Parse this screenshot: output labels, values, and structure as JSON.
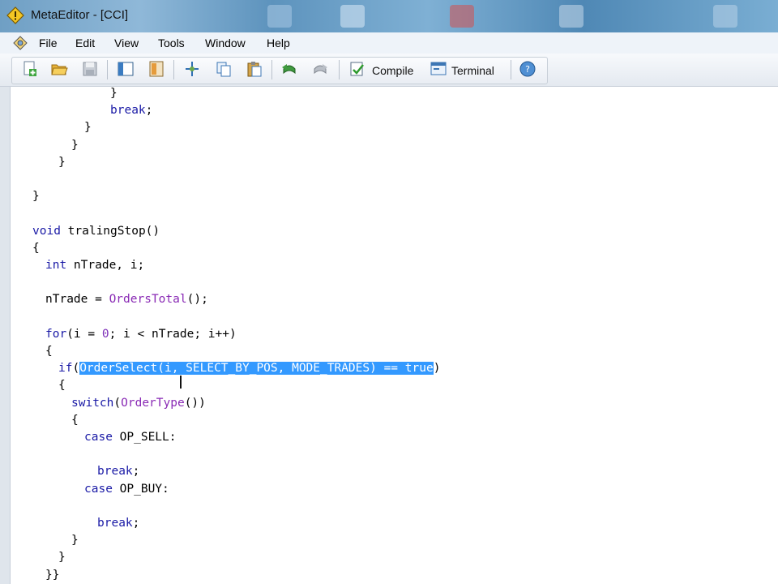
{
  "window": {
    "title": "MetaEditor - [CCI]"
  },
  "menu": {
    "items": [
      "File",
      "Edit",
      "View",
      "Tools",
      "Window",
      "Help"
    ]
  },
  "toolbar": {
    "compile_label": "Compile",
    "terminal_label": "Terminal"
  },
  "code": {
    "lines": [
      {
        "indent": "            ",
        "text": "}"
      },
      {
        "indent": "            ",
        "text": "break;"
      },
      {
        "indent": "        ",
        "text": "}"
      },
      {
        "indent": "      ",
        "text": "}"
      },
      {
        "indent": "    ",
        "text": "}"
      },
      {
        "indent": "",
        "text": ""
      },
      {
        "indent": "",
        "text": "}"
      },
      {
        "indent": "",
        "text": ""
      },
      {
        "indent": "",
        "text": "void tralingStop()"
      },
      {
        "indent": "",
        "text": "{"
      },
      {
        "indent": "  ",
        "text": "int nTrade, i;"
      },
      {
        "indent": "",
        "text": ""
      },
      {
        "indent": "  ",
        "text": "nTrade = OrdersTotal();"
      },
      {
        "indent": "",
        "text": ""
      },
      {
        "indent": "  ",
        "text": "for(i = 0; i < nTrade; i++)"
      },
      {
        "indent": "  ",
        "text": "{"
      },
      {
        "indent": "    ",
        "text": "if(OrderSelect(i, SELECT_BY_POS, MODE_TRADES) == true)"
      },
      {
        "indent": "    ",
        "text": "{"
      },
      {
        "indent": "      ",
        "text": "switch(OrderType())"
      },
      {
        "indent": "      ",
        "text": "{"
      },
      {
        "indent": "        ",
        "text": "case OP_SELL:"
      },
      {
        "indent": "",
        "text": ""
      },
      {
        "indent": "          ",
        "text": "break;"
      },
      {
        "indent": "        ",
        "text": "case OP_BUY:"
      },
      {
        "indent": "",
        "text": ""
      },
      {
        "indent": "          ",
        "text": "break;"
      },
      {
        "indent": "      ",
        "text": "}"
      },
      {
        "indent": "    ",
        "text": "}"
      },
      {
        "indent": "  ",
        "text": "}}"
      }
    ],
    "selection": "OrderSelect(i, SELECT_BY_POS, MODE_TRADES) == true"
  },
  "icons": {
    "app": "metaeditor-diamond-icon",
    "toolbar": [
      "new-file-icon",
      "open-folder-icon",
      "save-icon",
      "navigator-icon",
      "toolbox-icon",
      "cut-icon",
      "copy-icon",
      "paste-icon",
      "undo-icon",
      "redo-icon",
      "compile-icon",
      "terminal-icon",
      "help-icon"
    ]
  },
  "colors": {
    "keyword": "#1a1aa6",
    "function": "#8a2bb5",
    "selection": "#3399ff"
  }
}
